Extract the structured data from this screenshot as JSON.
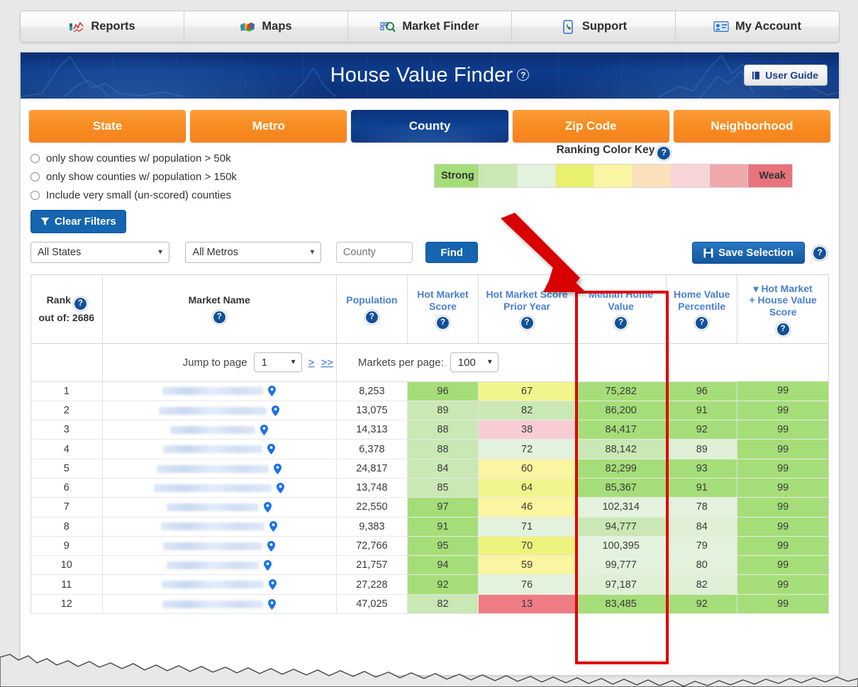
{
  "topnav": {
    "items": [
      {
        "label": "Reports",
        "icon": "reports-chart-icon"
      },
      {
        "label": "Maps",
        "icon": "usa-map-icon"
      },
      {
        "label": "Market Finder",
        "icon": "magnifier-grid-icon"
      },
      {
        "label": "Support",
        "icon": "phone-icon"
      },
      {
        "label": "My Account",
        "icon": "id-card-icon"
      }
    ]
  },
  "banner": {
    "title": "House Value Finder",
    "help": "?",
    "user_guide": "User Guide",
    "user_guide_icon": "book-icon"
  },
  "geotabs": [
    {
      "label": "State",
      "active": false
    },
    {
      "label": "Metro",
      "active": false
    },
    {
      "label": "County",
      "active": true
    },
    {
      "label": "Zip Code",
      "active": false
    },
    {
      "label": "Neighborhood",
      "active": false
    }
  ],
  "filters": {
    "radios": [
      "only show counties w/ population > 50k",
      "only show counties w/ population > 150k",
      "Include very small (un-scored) counties"
    ],
    "clear_label": "Clear Filters",
    "clear_icon": "funnel-icon"
  },
  "color_key": {
    "title": "Ranking Color Key",
    "help": "?",
    "strong_label": "Strong",
    "weak_label": "Weak",
    "swatches": [
      "#a5de78",
      "#c9e8b4",
      "#e3f2dc",
      "#e9f06e",
      "#faf5a0",
      "#fce0bb",
      "#f7d4d8",
      "#f0a8ad",
      "#e8737c"
    ]
  },
  "selectors": {
    "state": "All States",
    "metro": "All Metros",
    "county_placeholder": "County",
    "county_value": "",
    "find_label": "Find",
    "save_label": "Save Selection",
    "save_icon": "floppy-disk-icon",
    "save_help": "?"
  },
  "table": {
    "headers": [
      {
        "line1": "Rank",
        "line2": "out of: 2686",
        "style": "dark",
        "help": "?",
        "sorted": false
      },
      {
        "line1": "Market Name",
        "line2": "",
        "style": "dark",
        "help": "?",
        "sorted": false
      },
      {
        "line1": "Population",
        "line2": "",
        "style": "link",
        "help": "?",
        "sorted": false
      },
      {
        "line1": "Hot Market",
        "line2": "Score",
        "style": "link",
        "help": "?",
        "sorted": false
      },
      {
        "line1": "Hot Market Score",
        "line2": "Prior Year",
        "style": "link",
        "help": "?",
        "sorted": false
      },
      {
        "line1": "Median Home",
        "line2": "Value",
        "style": "link",
        "help": "?",
        "sorted": false
      },
      {
        "line1": "Home Value",
        "line2": "Percentile",
        "style": "link",
        "help": "?",
        "sorted": false
      },
      {
        "line1": "Hot Market",
        "line2": "+ House Value",
        "line3": "Score",
        "style": "link",
        "help": "?",
        "sorted": true,
        "sort_glyph": "▾"
      }
    ],
    "pagination": {
      "jump_label": "Jump to page",
      "page_value": "1",
      "next_label": ">",
      "last_label": ">>",
      "per_page_label": "Markets per page:",
      "per_page_value": "100"
    },
    "rows": [
      {
        "rank": "1",
        "name_width": 142,
        "population": "8,253",
        "hot": "96",
        "hot_prior": "67",
        "median": "75,282",
        "pct": "96",
        "combined": "99",
        "c_hot": "#a5de78",
        "c_prior": "#f2f58b",
        "c_median": "#a5de78",
        "c_pct": "#a5de78",
        "c_comb": "#a5de78"
      },
      {
        "rank": "2",
        "name_width": 152,
        "population": "13,075",
        "hot": "89",
        "hot_prior": "82",
        "median": "86,200",
        "pct": "91",
        "combined": "99",
        "c_hot": "#c9e8b4",
        "c_prior": "#c9e8b4",
        "c_median": "#a5de78",
        "c_pct": "#a5de78",
        "c_comb": "#a5de78"
      },
      {
        "rank": "3",
        "name_width": 120,
        "population": "14,313",
        "hot": "88",
        "hot_prior": "38",
        "median": "84,417",
        "pct": "92",
        "combined": "99",
        "c_hot": "#c9e8b4",
        "c_prior": "#f7ccd2",
        "c_median": "#a5de78",
        "c_pct": "#a5de78",
        "c_comb": "#a5de78"
      },
      {
        "rank": "4",
        "name_width": 140,
        "population": "6,378",
        "hot": "88",
        "hot_prior": "72",
        "median": "88,142",
        "pct": "89",
        "combined": "99",
        "c_hot": "#c9e8b4",
        "c_prior": "#e3f2dc",
        "c_median": "#c9e8b4",
        "c_pct": "#dff0d6",
        "c_comb": "#a5de78"
      },
      {
        "rank": "5",
        "name_width": 158,
        "population": "24,817",
        "hot": "84",
        "hot_prior": "60",
        "median": "82,299",
        "pct": "93",
        "combined": "99",
        "c_hot": "#c9e8b4",
        "c_prior": "#faf5a0",
        "c_median": "#a5de78",
        "c_pct": "#a5de78",
        "c_comb": "#a5de78"
      },
      {
        "rank": "6",
        "name_width": 166,
        "population": "13,748",
        "hot": "85",
        "hot_prior": "64",
        "median": "85,367",
        "pct": "91",
        "combined": "99",
        "c_hot": "#c9e8b4",
        "c_prior": "#f2f58b",
        "c_median": "#a5de78",
        "c_pct": "#a5de78",
        "c_comb": "#a5de78"
      },
      {
        "rank": "7",
        "name_width": 130,
        "population": "22,550",
        "hot": "97",
        "hot_prior": "46",
        "median": "102,314",
        "pct": "78",
        "combined": "99",
        "c_hot": "#a5de78",
        "c_prior": "#faf5a0",
        "c_median": "#e3f2dc",
        "c_pct": "#e3f2dc",
        "c_comb": "#a5de78"
      },
      {
        "rank": "8",
        "name_width": 146,
        "population": "9,383",
        "hot": "91",
        "hot_prior": "71",
        "median": "94,777",
        "pct": "84",
        "combined": "99",
        "c_hot": "#a5de78",
        "c_prior": "#e3f2dc",
        "c_median": "#c9e8b4",
        "c_pct": "#dff0d6",
        "c_comb": "#a5de78"
      },
      {
        "rank": "9",
        "name_width": 140,
        "population": "72,766",
        "hot": "95",
        "hot_prior": "70",
        "median": "100,395",
        "pct": "79",
        "combined": "99",
        "c_hot": "#a5de78",
        "c_prior": "#eef37e",
        "c_median": "#e3f2dc",
        "c_pct": "#e3f2dc",
        "c_comb": "#a5de78"
      },
      {
        "rank": "10",
        "name_width": 130,
        "population": "21,757",
        "hot": "94",
        "hot_prior": "59",
        "median": "99,777",
        "pct": "80",
        "combined": "99",
        "c_hot": "#a5de78",
        "c_prior": "#faf5a0",
        "c_median": "#e3f2dc",
        "c_pct": "#e3f2dc",
        "c_comb": "#a5de78"
      },
      {
        "rank": "11",
        "name_width": 144,
        "population": "27,228",
        "hot": "92",
        "hot_prior": "76",
        "median": "97,187",
        "pct": "82",
        "combined": "99",
        "c_hot": "#a5de78",
        "c_prior": "#e3f2dc",
        "c_median": "#dff0d6",
        "c_pct": "#dff0d6",
        "c_comb": "#a5de78"
      },
      {
        "rank": "12",
        "name_width": 142,
        "population": "47,025",
        "hot": "82",
        "hot_prior": "13",
        "median": "83,485",
        "pct": "92",
        "combined": "99",
        "c_hot": "#c9e8b4",
        "c_prior": "#ef7b84",
        "c_median": "#a5de78",
        "c_pct": "#a5de78",
        "c_comb": "#a5de78"
      }
    ]
  },
  "annotations": {
    "highlight_color": "#e00000",
    "arrow_name": "red-arrow-pointing-to-median-home-value-column"
  }
}
